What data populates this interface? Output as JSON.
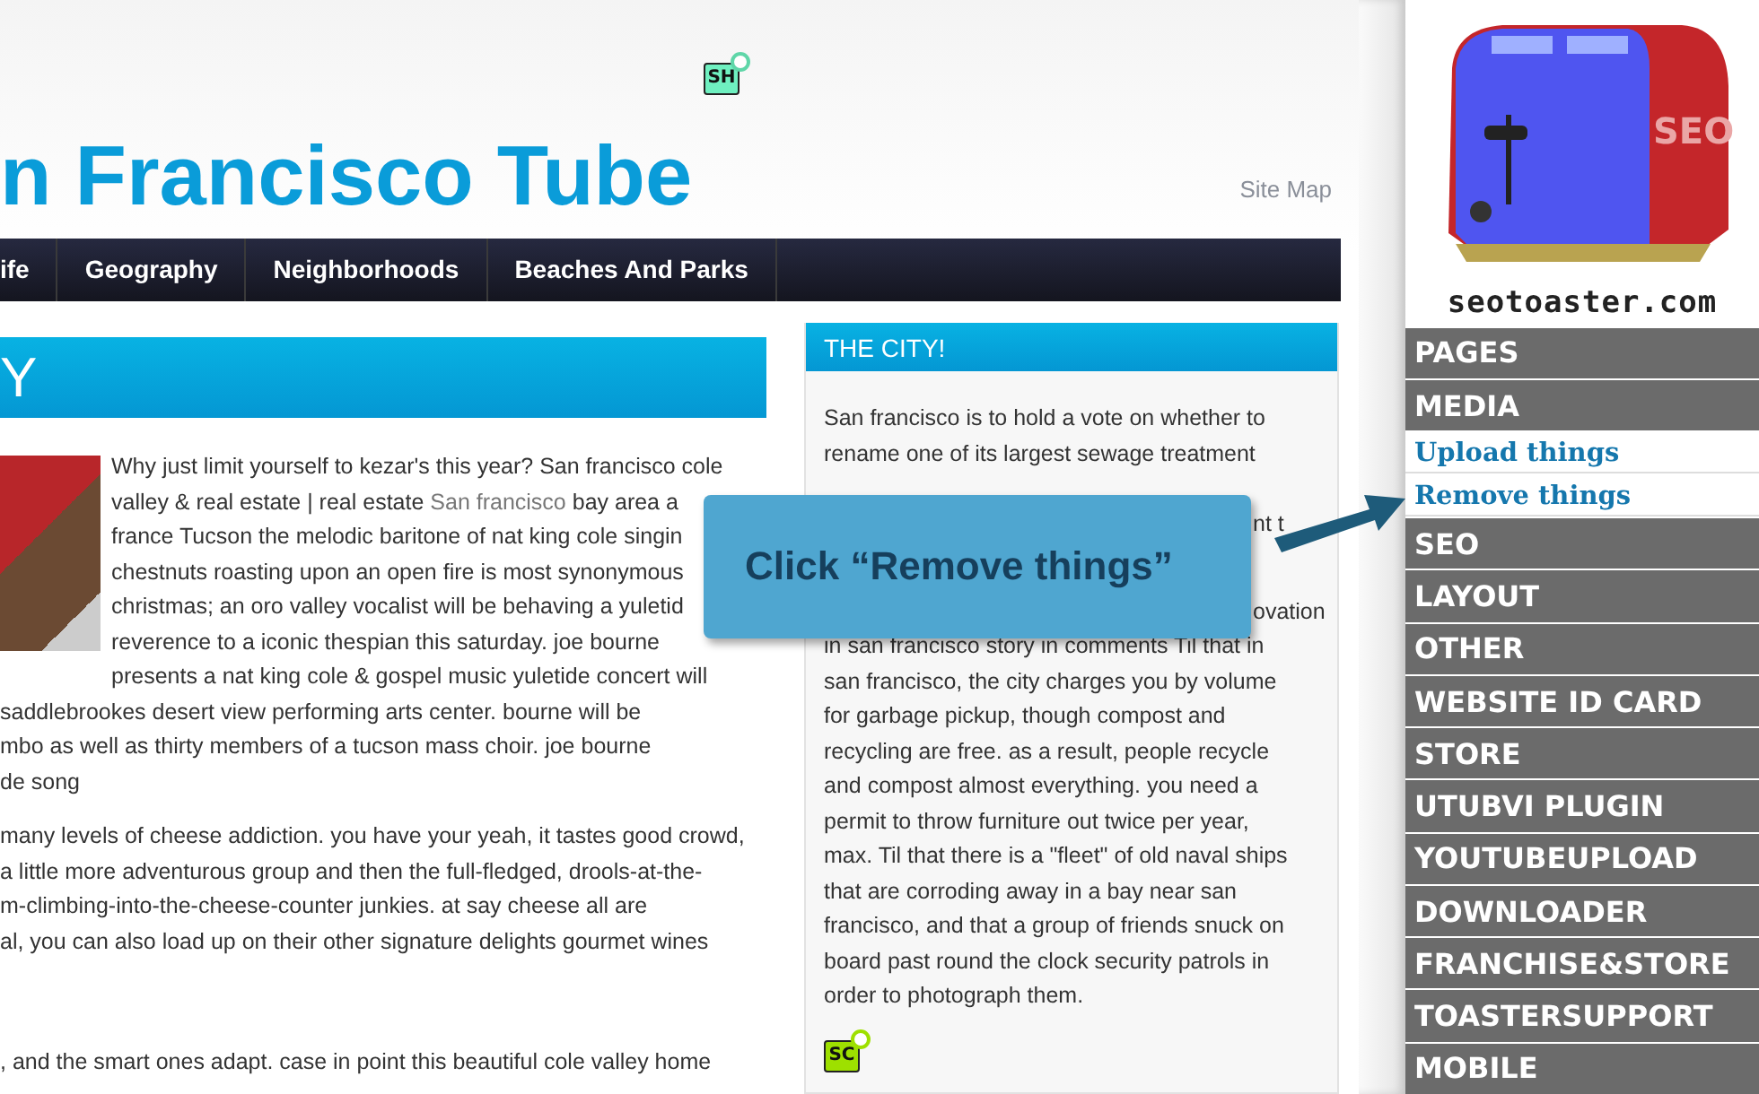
{
  "header": {
    "badge": "SH",
    "site_title": "n Francisco Tube",
    "site_map": "Site Map"
  },
  "top_nav": [
    {
      "label": "ife"
    },
    {
      "label": "Geography"
    },
    {
      "label": "Neighborhoods"
    },
    {
      "label": "Beaches And Parks"
    }
  ],
  "article": {
    "heading": "Y",
    "paragraphs": [
      {
        "lines": [
          {
            "text": "Why just limit yourself to kezar's this year? San francisco cole"
          },
          {
            "text": "valley & real estate | real estate ",
            "link": "San francisco",
            "after": " bay area a"
          },
          {
            "text": "france Tucson the melodic baritone of nat king cole singin"
          },
          {
            "text": "chestnuts roasting upon an open fire is most synonymous"
          },
          {
            "text": "christmas; an oro valley vocalist will be behaving a yuletid"
          },
          {
            "text": "reverence to a iconic thespian this saturday. joe bourne"
          },
          {
            "text": "presents a nat king cole & gospel music yuletide concert will"
          },
          {
            "text": "saddlebrookes desert view performing arts center. bourne will be"
          },
          {
            "text": "mbo as well as thirty members of a tucson mass choir. joe bourne"
          },
          {
            "text": "de song"
          }
        ]
      },
      {
        "lines": [
          {
            "text": "many levels of cheese addiction. you have your yeah, it tastes good crowd,"
          },
          {
            "text": "a little more adventurous group and then the full-fledged, drools-at-the-"
          },
          {
            "text": "m-climbing-into-the-cheese-counter junkies. at say cheese all are"
          },
          {
            "text": "al, you can also load up on their other signature delights gourmet wines"
          }
        ]
      },
      {
        "lines": [
          {
            "text": ", and the smart ones adapt. case in point this beautiful cole valley home"
          }
        ]
      }
    ]
  },
  "side_box": {
    "title": "THE CITY!",
    "badge": "SC",
    "paragraphs": [
      {
        "lines": [
          {
            "kind": "plain",
            "text": "San francisco is to hold a vote on whether to"
          },
          {
            "kind": "plain",
            "text": "rename one of its largest sewage treatment"
          },
          {
            "kind": "covered",
            "text": "nt t"
          }
        ]
      },
      {
        "lines": [
          {
            "kind": "covered",
            "text": "ovation"
          },
          "in san francisco story in comments Til that in",
          "san francisco, the city charges you by volume",
          "for garbage pickup, though compost and",
          "recycling are free. as a result, people recycle",
          "and compost almost everything. you need a",
          "permit to throw furniture out twice per year,",
          "max. Til that there is a \"fleet\" of old naval ships",
          "that are corroding away in a bay near san",
          "francisco, and that a group of friends snuck on",
          "board past round the clock security patrols in",
          "order to photograph them."
        ]
      }
    ]
  },
  "callout": {
    "text": "Click “Remove things”"
  },
  "sidebar": {
    "logo_mark": "SEO",
    "logo_caption": "seotoaster.com",
    "menu": [
      {
        "label": "PAGES"
      },
      {
        "label": "MEDIA",
        "expanded": true,
        "children": [
          {
            "label": "Upload things"
          },
          {
            "label": "Remove things"
          }
        ]
      },
      {
        "label": "SEO"
      },
      {
        "label": "LAYOUT"
      },
      {
        "label": "OTHER"
      },
      {
        "label": "WEBSITE ID CARD"
      },
      {
        "label": "STORE"
      },
      {
        "label": "UTUBVI PLUGIN"
      },
      {
        "label": "YOUTUBEUPLOAD"
      },
      {
        "label": "DOWNLOADER"
      },
      {
        "label": "FRANCHISE&STORE"
      },
      {
        "label": "TOASTERSUPPORT"
      },
      {
        "label": "MOBILE"
      }
    ]
  }
}
